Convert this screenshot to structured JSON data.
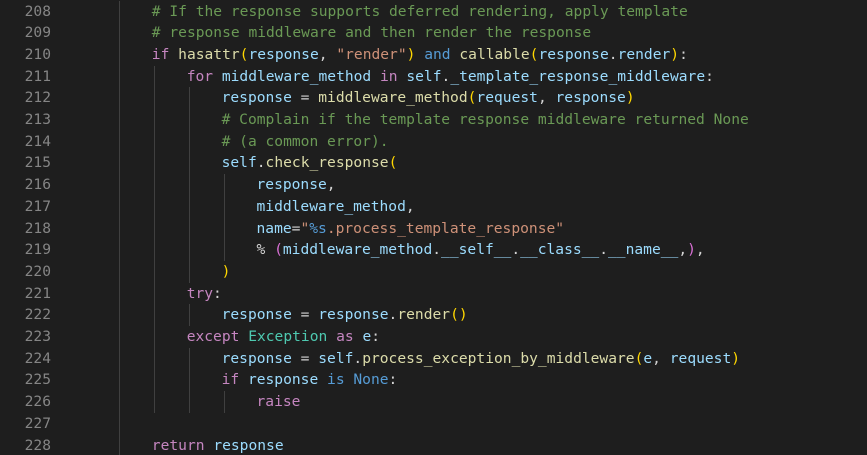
{
  "editor": {
    "colors": {
      "background": "#1e1e1e",
      "line_number": "#858585",
      "comment": "#6a9955",
      "keyword_control": "#c586c0",
      "keyword_storage": "#569cd6",
      "function": "#dcdcaa",
      "variable": "#9cdcfe",
      "string": "#ce9178",
      "bracket_yellow": "#ffd700",
      "bracket_purple": "#da70d6",
      "bracket_blue": "#179fff",
      "class_name": "#4ec9b0",
      "plain": "#d4d4d4"
    },
    "lines": [
      {
        "number": "208",
        "indent": 2,
        "tokens": [
          {
            "t": "# If the response supports deferred rendering, apply template",
            "c": "comment"
          }
        ]
      },
      {
        "number": "209",
        "indent": 2,
        "tokens": [
          {
            "t": "# response middleware and then render the response",
            "c": "comment"
          }
        ]
      },
      {
        "number": "210",
        "indent": 2,
        "tokens": [
          {
            "t": "if ",
            "c": "keyword_control"
          },
          {
            "t": "hasattr",
            "c": "function"
          },
          {
            "t": "(",
            "c": "bracket_yellow"
          },
          {
            "t": "response",
            "c": "variable"
          },
          {
            "t": ", ",
            "c": "plain"
          },
          {
            "t": "\"render\"",
            "c": "string"
          },
          {
            "t": ") ",
            "c": "bracket_yellow"
          },
          {
            "t": "and ",
            "c": "keyword_storage"
          },
          {
            "t": "callable",
            "c": "function"
          },
          {
            "t": "(",
            "c": "bracket_yellow"
          },
          {
            "t": "response",
            "c": "variable"
          },
          {
            "t": ".",
            "c": "plain"
          },
          {
            "t": "render",
            "c": "variable"
          },
          {
            "t": ")",
            "c": "bracket_yellow"
          },
          {
            "t": ":",
            "c": "plain"
          }
        ]
      },
      {
        "number": "211",
        "indent": 3,
        "tokens": [
          {
            "t": "for ",
            "c": "keyword_control"
          },
          {
            "t": "middleware_method ",
            "c": "variable"
          },
          {
            "t": "in ",
            "c": "keyword_control"
          },
          {
            "t": "self",
            "c": "variable"
          },
          {
            "t": ".",
            "c": "plain"
          },
          {
            "t": "_template_response_middleware",
            "c": "variable"
          },
          {
            "t": ":",
            "c": "plain"
          }
        ]
      },
      {
        "number": "212",
        "indent": 4,
        "tokens": [
          {
            "t": "response ",
            "c": "variable"
          },
          {
            "t": "= ",
            "c": "plain"
          },
          {
            "t": "middleware_method",
            "c": "function"
          },
          {
            "t": "(",
            "c": "bracket_yellow"
          },
          {
            "t": "request",
            "c": "variable"
          },
          {
            "t": ", ",
            "c": "plain"
          },
          {
            "t": "response",
            "c": "variable"
          },
          {
            "t": ")",
            "c": "bracket_yellow"
          }
        ]
      },
      {
        "number": "213",
        "indent": 4,
        "tokens": [
          {
            "t": "# Complain if the template response middleware returned None",
            "c": "comment"
          }
        ]
      },
      {
        "number": "214",
        "indent": 4,
        "tokens": [
          {
            "t": "# (a common error).",
            "c": "comment"
          }
        ]
      },
      {
        "number": "215",
        "indent": 4,
        "tokens": [
          {
            "t": "self",
            "c": "variable"
          },
          {
            "t": ".",
            "c": "plain"
          },
          {
            "t": "check_response",
            "c": "function"
          },
          {
            "t": "(",
            "c": "bracket_yellow"
          }
        ]
      },
      {
        "number": "216",
        "indent": 5,
        "tokens": [
          {
            "t": "response",
            "c": "variable"
          },
          {
            "t": ",",
            "c": "plain"
          }
        ]
      },
      {
        "number": "217",
        "indent": 5,
        "tokens": [
          {
            "t": "middleware_method",
            "c": "variable"
          },
          {
            "t": ",",
            "c": "plain"
          }
        ]
      },
      {
        "number": "218",
        "indent": 5,
        "tokens": [
          {
            "t": "name",
            "c": "variable"
          },
          {
            "t": "=",
            "c": "plain"
          },
          {
            "t": "\"",
            "c": "string"
          },
          {
            "t": "%s",
            "c": "keyword_storage"
          },
          {
            "t": ".process_template_response\"",
            "c": "string"
          }
        ]
      },
      {
        "number": "219",
        "indent": 5,
        "tokens": [
          {
            "t": "% ",
            "c": "plain"
          },
          {
            "t": "(",
            "c": "bracket_purple"
          },
          {
            "t": "middleware_method",
            "c": "variable"
          },
          {
            "t": ".",
            "c": "plain"
          },
          {
            "t": "__self__",
            "c": "variable"
          },
          {
            "t": ".",
            "c": "plain"
          },
          {
            "t": "__class__",
            "c": "variable"
          },
          {
            "t": ".",
            "c": "plain"
          },
          {
            "t": "__name__",
            "c": "variable"
          },
          {
            "t": ",",
            "c": "plain"
          },
          {
            "t": ")",
            "c": "bracket_purple"
          },
          {
            "t": ",",
            "c": "plain"
          }
        ]
      },
      {
        "number": "220",
        "indent": 4,
        "tokens": [
          {
            "t": ")",
            "c": "bracket_yellow"
          }
        ]
      },
      {
        "number": "221",
        "indent": 3,
        "tokens": [
          {
            "t": "try",
            "c": "keyword_control"
          },
          {
            "t": ":",
            "c": "plain"
          }
        ]
      },
      {
        "number": "222",
        "indent": 4,
        "tokens": [
          {
            "t": "response ",
            "c": "variable"
          },
          {
            "t": "= ",
            "c": "plain"
          },
          {
            "t": "response",
            "c": "variable"
          },
          {
            "t": ".",
            "c": "plain"
          },
          {
            "t": "render",
            "c": "function"
          },
          {
            "t": "()",
            "c": "bracket_yellow"
          }
        ]
      },
      {
        "number": "223",
        "indent": 3,
        "tokens": [
          {
            "t": "except ",
            "c": "keyword_control"
          },
          {
            "t": "Exception ",
            "c": "class_name"
          },
          {
            "t": "as ",
            "c": "keyword_control"
          },
          {
            "t": "e",
            "c": "variable"
          },
          {
            "t": ":",
            "c": "plain"
          }
        ]
      },
      {
        "number": "224",
        "indent": 4,
        "tokens": [
          {
            "t": "response ",
            "c": "variable"
          },
          {
            "t": "= ",
            "c": "plain"
          },
          {
            "t": "self",
            "c": "variable"
          },
          {
            "t": ".",
            "c": "plain"
          },
          {
            "t": "process_exception_by_middleware",
            "c": "function"
          },
          {
            "t": "(",
            "c": "bracket_yellow"
          },
          {
            "t": "e",
            "c": "variable"
          },
          {
            "t": ", ",
            "c": "plain"
          },
          {
            "t": "request",
            "c": "variable"
          },
          {
            "t": ")",
            "c": "bracket_yellow"
          }
        ]
      },
      {
        "number": "225",
        "indent": 4,
        "tokens": [
          {
            "t": "if ",
            "c": "keyword_control"
          },
          {
            "t": "response ",
            "c": "variable"
          },
          {
            "t": "is ",
            "c": "keyword_storage"
          },
          {
            "t": "None",
            "c": "keyword_storage"
          },
          {
            "t": ":",
            "c": "plain"
          }
        ]
      },
      {
        "number": "226",
        "indent": 5,
        "tokens": [
          {
            "t": "raise",
            "c": "keyword_control"
          }
        ]
      },
      {
        "number": "227",
        "indent": 0,
        "tokens": []
      },
      {
        "number": "228",
        "indent": 2,
        "tokens": [
          {
            "t": "return ",
            "c": "keyword_control"
          },
          {
            "t": "response",
            "c": "variable"
          }
        ]
      }
    ]
  }
}
